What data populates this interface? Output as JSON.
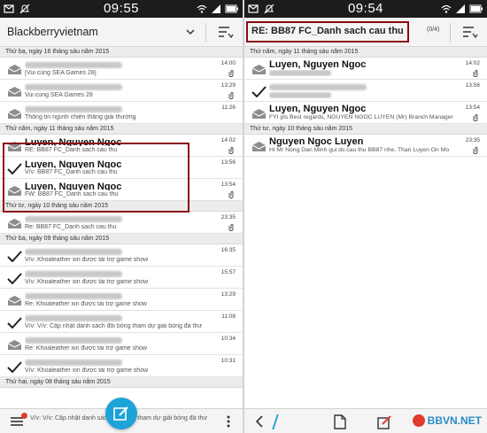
{
  "colors": {
    "accent": "#1ea3d8",
    "highlight": "#8b0d0d",
    "statusbar": "#1c1c1c",
    "badge": "#e13b2d"
  },
  "left": {
    "time": "09:55",
    "account": "Blackberryvietnam",
    "groups": [
      {
        "date": "Thứ ba, ngày 16 tháng sáu năm 2015",
        "rows": [
          {
            "icon": "envelope-open-icon",
            "sender": "",
            "preview": "[Vui cùng SEA Games 28]",
            "time": "14:00",
            "attach": true
          },
          {
            "icon": "envelope-open-icon",
            "sender": "",
            "preview": "Vui cùng SEA Games 28",
            "time": "13:29",
            "attach": true
          },
          {
            "icon": "envelope-open-icon",
            "sender": "",
            "preview": "Thông tin người chiến thắng giải thưởng",
            "time": "11:26",
            "attach": false
          }
        ]
      },
      {
        "date": "Thứ năm, ngày 11 tháng sáu năm 2015",
        "rows": [
          {
            "icon": "envelope-open-icon",
            "sender": "Luyen, Nguyen Ngoc",
            "preview": "RE: BB87 FC_Danh sach cau thu",
            "time": "14:02",
            "attach": true
          },
          {
            "icon": "checkmark-icon",
            "sender": "Luyen, Nguyen Ngoc",
            "preview": "V/v: BB87 FC_Danh sach cau thu",
            "time": "13:56",
            "attach": false
          },
          {
            "icon": "envelope-open-icon",
            "sender": "Luyen, Nguyen Ngoc",
            "preview": "FW: BB87 FC_Danh sach cau thu",
            "time": "13:54",
            "attach": true
          }
        ]
      },
      {
        "date": "Thứ tư, ngày 10 tháng sáu năm 2015",
        "rows": [
          {
            "icon": "envelope-open-icon",
            "sender": "",
            "preview": "Re: BB87 FC_Danh sach cau thu",
            "time": "23:35",
            "attach": true
          }
        ]
      },
      {
        "date": "Thứ ba, ngày 09 tháng sáu năm 2015",
        "rows": [
          {
            "icon": "checkmark-icon",
            "sender": "",
            "preview": "V/v: Khoaleather xin được tài trợ game show",
            "time": "16:35",
            "attach": false
          },
          {
            "icon": "checkmark-icon",
            "sender": "",
            "preview": "V/v: Khoaleather xin được tài trợ game show",
            "time": "15:57",
            "attach": false
          },
          {
            "icon": "envelope-open-icon",
            "sender": "",
            "preview": "Re: Khoaleather xin được tài trợ game show",
            "time": "13:29",
            "attach": false
          },
          {
            "icon": "checkmark-icon",
            "sender": "",
            "preview": "V/v: V/v: Cập nhật danh sách đội bóng tham dự giải bóng đá thư",
            "time": "11:08",
            "attach": false
          },
          {
            "icon": "envelope-open-icon",
            "sender": "",
            "preview": "Re: Khoaleather xin được tài trợ game show",
            "time": "10:34",
            "attach": false
          },
          {
            "icon": "checkmark-icon",
            "sender": "",
            "preview": "V/v: Khoaleather xin được tài trợ game show",
            "time": "10:31",
            "attach": false
          }
        ]
      },
      {
        "date": "Thứ hai, ngày 08 tháng sáu năm 2015",
        "rows": []
      }
    ],
    "bottom_peek": "V/v: V/v: Cập nhật danh sách đội bóng tham dự giải bóng đá thư"
  },
  "right": {
    "time": "09:54",
    "subject": "RE: BB87 FC_Danh sach cau thu",
    "counter": "(0/4)",
    "groups": [
      {
        "date": "Thứ năm, ngày 11 tháng sáu năm 2015",
        "rows": [
          {
            "icon": "envelope-open-icon",
            "sender": "Luyen, Nguyen Ngoc",
            "preview": "",
            "time": "14:02",
            "attach": true
          },
          {
            "icon": "checkmark-icon",
            "sender": "",
            "preview": "",
            "time": "13:56",
            "attach": false
          },
          {
            "icon": "envelope-open-icon",
            "sender": "Luyen, Nguyen Ngoc",
            "preview": "FYI pls   Best regards,   NGUYEN NGOC LUYEN (Mr)  Branch Manager",
            "time": "13:54",
            "attach": true
          }
        ]
      },
      {
        "date": "Thứ tư, ngày 10 tháng sáu năm 2015",
        "rows": [
          {
            "icon": "envelope-open-icon",
            "sender": "Nguyen Ngoc Luyen",
            "preview": "Hi Mr Nong Dan   Minh gui ds cau thu BB87 nhe.   Than Luyen   On Mo",
            "time": "23:35",
            "attach": true
          }
        ]
      }
    ],
    "watermark": "BBVN.NET"
  }
}
